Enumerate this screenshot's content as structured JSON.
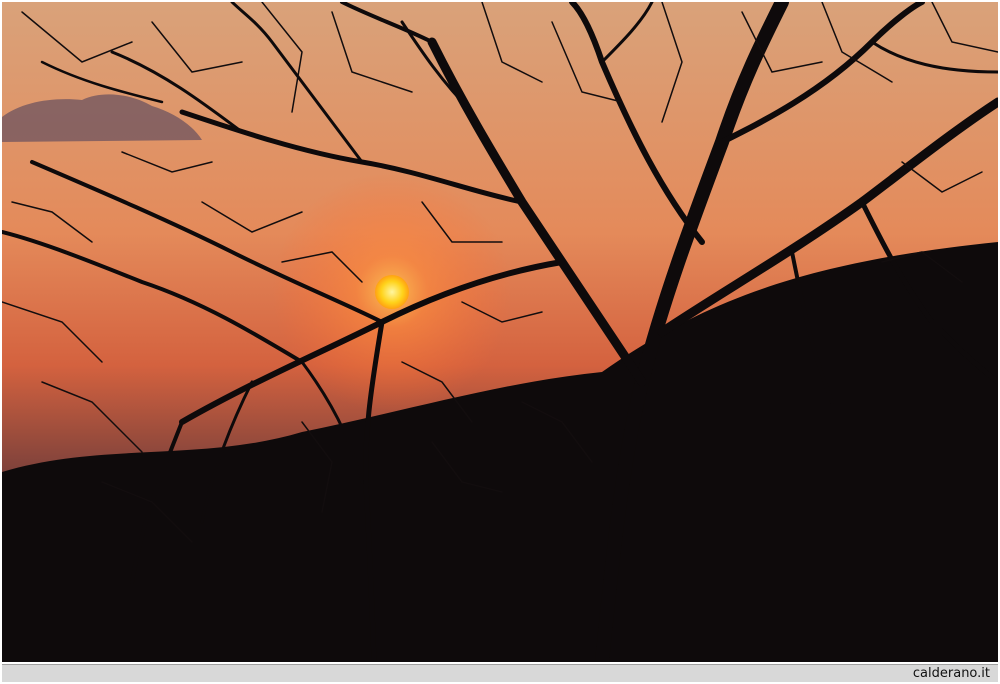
{
  "photo": {
    "subject": "sunset-through-bare-tree-branches",
    "colors": {
      "sky_top": "#d9956a",
      "sky_mid": "#e8804f",
      "sky_low": "#c95a3a",
      "sun": "#ffd21a",
      "silhouette": "#0e0a0b"
    }
  },
  "credit": {
    "text": "calderano.it"
  }
}
